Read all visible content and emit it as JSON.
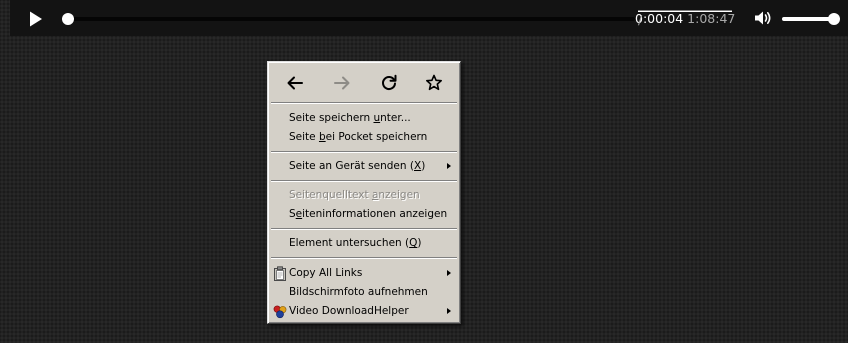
{
  "player": {
    "current_time": "0:00:04",
    "separator": "/",
    "duration": "1:08:47",
    "progress_fraction": 0.002,
    "volume_fraction": 1.0,
    "icons": {
      "play": "play-icon",
      "volume": "volume-icon"
    }
  },
  "context_menu": {
    "nav": [
      {
        "name": "back-icon",
        "enabled": true
      },
      {
        "name": "forward-icon",
        "enabled": false
      },
      {
        "name": "reload-icon",
        "enabled": true
      },
      {
        "name": "bookmark-star-icon",
        "enabled": true
      }
    ],
    "items": {
      "save_page": {
        "pre": "Seite speichern ",
        "key": "u",
        "post": "nter..."
      },
      "pocket": {
        "pre": "Seite ",
        "key": "b",
        "post": "ei Pocket speichern"
      },
      "send_page": {
        "pre": "Seite an Gerät senden (",
        "key": "X",
        "post": ")"
      },
      "view_source": {
        "pre": "Seitenquelltext ",
        "key": "a",
        "post": "nzeigen"
      },
      "page_info": {
        "pre": "S",
        "key": "e",
        "post": "iteninformationen anzeigen"
      },
      "inspect": {
        "pre": "Element untersuchen (",
        "key": "Q",
        "post": ")"
      },
      "copy_links": {
        "label": "Copy All Links"
      },
      "screenshot": {
        "label": "Bildschirmfoto aufnehmen"
      },
      "video_helper": {
        "label": "Video DownloadHelper"
      }
    },
    "colors": {
      "background": "#d4d0c8",
      "disabled_text": "#8b8985"
    }
  }
}
